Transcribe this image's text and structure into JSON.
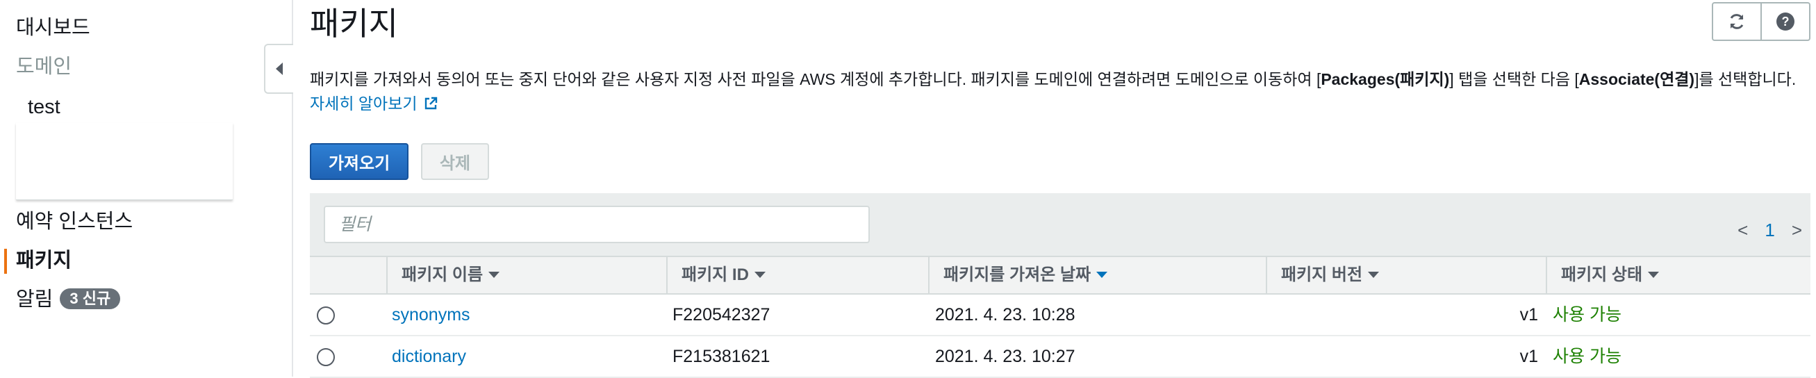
{
  "sidebar": {
    "items": [
      {
        "id": "dashboard",
        "label": "대시보드"
      },
      {
        "id": "domain",
        "label": "도메인"
      },
      {
        "id": "test",
        "label": "test"
      },
      {
        "id": "reserved",
        "label": "예약 인스턴스"
      },
      {
        "id": "packages",
        "label": "패키지"
      },
      {
        "id": "notifications",
        "label": "알림"
      }
    ],
    "notification_badge": "3 신규",
    "collapse_icon": "caret-left-icon",
    "active_accent": "#ec7211"
  },
  "header": {
    "title": "패키지",
    "refresh_icon": "refresh-icon",
    "help_icon": "help-icon"
  },
  "description": {
    "part1": "패키지를 가져와서 동의어 또는 중지 단어와 같은 사용자 지정 사전 파일을 AWS 계정에 추가합니다. 패키지를 도메인에 연결하려면 도메인으로 이동하여 [",
    "bold1": "Packages(패키지)",
    "part2": "] 탭을 선택한 다음 [",
    "bold2": "Associate(연결)",
    "part3": "]를 선택합니다. ",
    "link": "자세히 알아보기",
    "link_icon": "external-link-icon"
  },
  "actions": {
    "import_label": "가져오기",
    "delete_label": "삭제"
  },
  "filter": {
    "placeholder": "필터"
  },
  "pagination": {
    "prev": "<",
    "page": "1",
    "next": ">"
  },
  "table": {
    "columns": [
      "패키지 이름",
      "패키지 ID",
      "패키지를 가져온 날짜",
      "패키지 버전",
      "패키지 상태"
    ],
    "rows": [
      {
        "name": "synonyms",
        "id": "F220542327",
        "imported": "2021. 4. 23. 10:28",
        "version": "v1",
        "status": "사용 가능"
      },
      {
        "name": "dictionary",
        "id": "F215381621",
        "imported": "2021. 4. 23. 10:27",
        "version": "v1",
        "status": "사용 가능"
      }
    ]
  },
  "colors": {
    "primary": "#1f63b5",
    "link": "#0073bb",
    "status_ok": "#1d8102"
  }
}
